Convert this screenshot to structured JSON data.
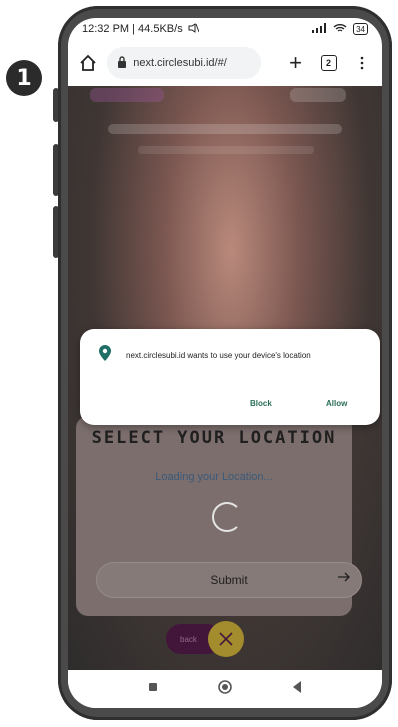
{
  "step": {
    "number": "1"
  },
  "status": {
    "time": "12:32 PM | 44.5KB/s",
    "battery": "34"
  },
  "browser": {
    "url": "next.circlesubi.id/#/",
    "tab_count": "2"
  },
  "dialog": {
    "message": "next.circlesubi.id wants to use your device's location",
    "block_label": "Block",
    "allow_label": "Allow"
  },
  "location_card": {
    "title": "SELECT YOUR LOCATION",
    "loading_text": "Loading your Location...",
    "submit_label": "Submit"
  },
  "bottom": {
    "back_label": "back"
  },
  "colors": {
    "accent_green": "#2a6e55",
    "back_purple": "#42163b",
    "close_gold": "#a38c2d"
  }
}
